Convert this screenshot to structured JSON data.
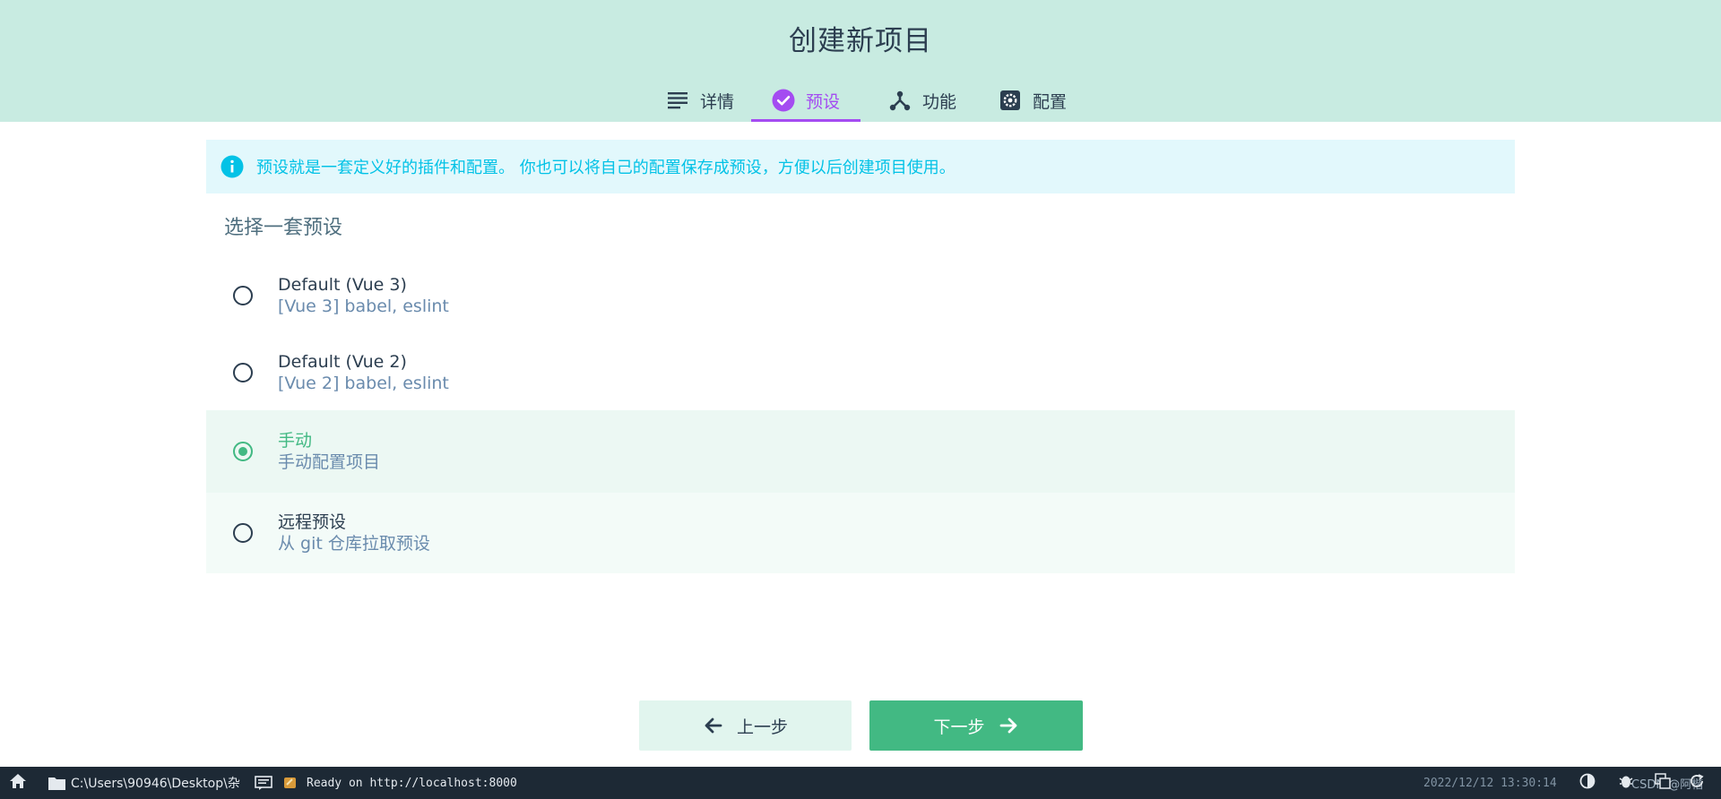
{
  "header": {
    "title": "创建新项目",
    "tabs": [
      {
        "label": "详情",
        "icon": "list-icon"
      },
      {
        "label": "预设",
        "icon": "check-circle-icon",
        "active": true
      },
      {
        "label": "功能",
        "icon": "fork-icon"
      },
      {
        "label": "配置",
        "icon": "settings-icon"
      }
    ]
  },
  "info": {
    "icon": "info-icon",
    "text": "预设就是一套定义好的插件和配置。 你也可以将自己的配置保存成预设，方便以后创建项目使用。"
  },
  "section_title": "选择一套预设",
  "presets": [
    {
      "name": "Default (Vue 3)",
      "desc": "[Vue 3] babel, eslint",
      "selected": false
    },
    {
      "name": "Default (Vue 2)",
      "desc": "[Vue 2] babel, eslint",
      "selected": false
    },
    {
      "name": "手动",
      "desc": "手动配置项目",
      "selected": true
    },
    {
      "name": "远程预设",
      "desc": "从 git 仓库拉取预设",
      "selected": false
    }
  ],
  "buttons": {
    "prev": "上一步",
    "next": "下一步"
  },
  "statusbar": {
    "path": "C:\\Users\\90946\\Desktop\\杂",
    "log": "Ready on http://localhost:8000",
    "timestamp": "2022/12/12 13:30:14",
    "watermark": "CSDN @阿楷"
  },
  "colors": {
    "header_bg": "#c8ebe1",
    "accent_purple": "#a44cf1",
    "accent_green": "#42b983",
    "info_text": "#03c2e6",
    "info_bg": "#e2f8fc",
    "statusbar_bg": "#1d2935"
  }
}
